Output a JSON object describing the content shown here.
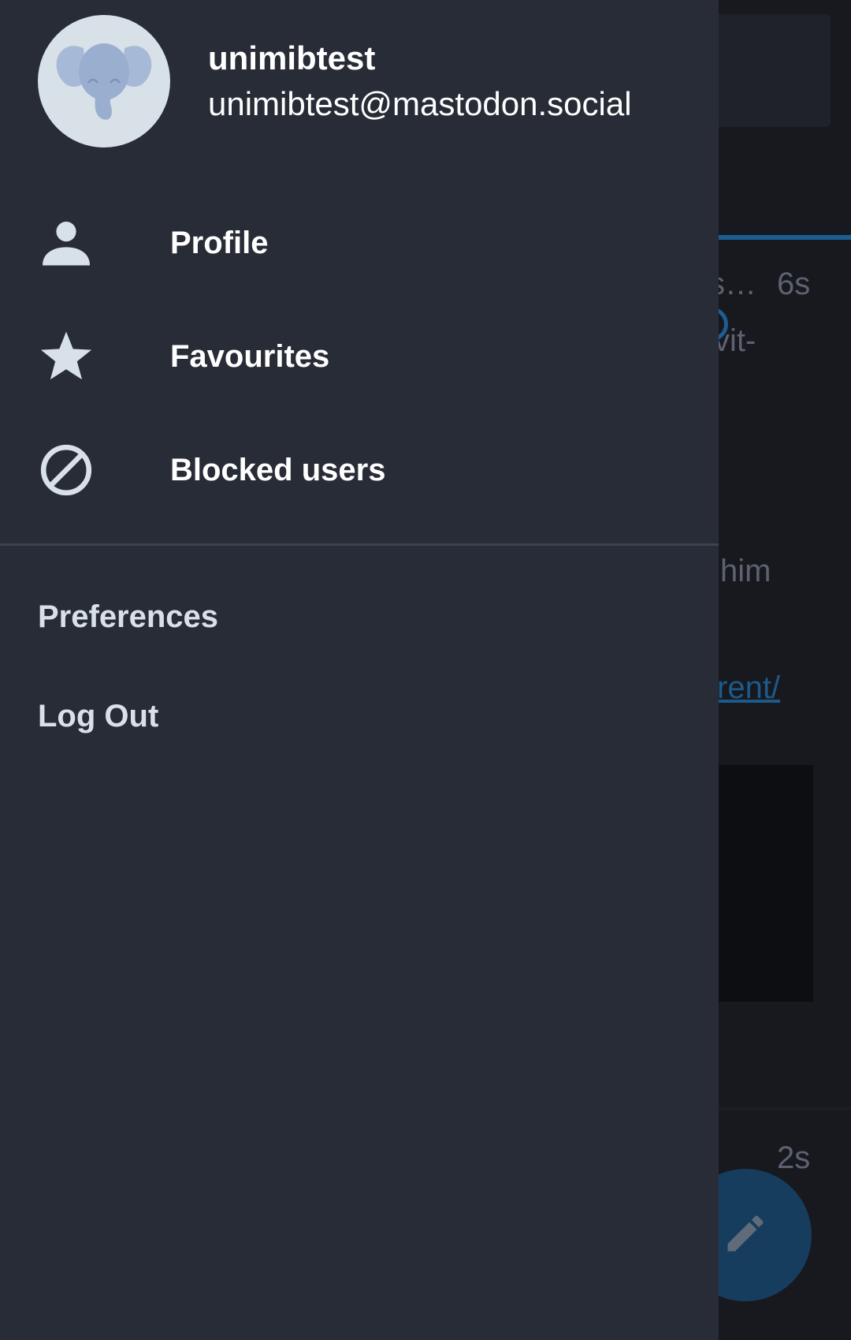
{
  "background": {
    "timeline_fragments": {
      "time_1": "6s",
      "text_1": "s…",
      "text_2": "vit-",
      "text_3": "him",
      "link_1": "rent/",
      "time_2": "2s"
    },
    "compose_fab_icon": "pencil-icon",
    "accent_color": "#2b90d9"
  },
  "drawer": {
    "account": {
      "display_name": "unimibtest",
      "handle": "unimibtest@mastodon.social",
      "avatar_icon": "elephant-icon"
    },
    "menu": [
      {
        "label": "Profile",
        "icon": "person-icon"
      },
      {
        "label": "Favourites",
        "icon": "star-icon"
      },
      {
        "label": "Blocked users",
        "icon": "block-icon"
      }
    ],
    "secondary": [
      {
        "label": "Preferences"
      },
      {
        "label": "Log Out"
      }
    ],
    "colors": {
      "drawer_bg": "#282c37",
      "icon": "#d9e1e8",
      "divider": "#3d4252"
    }
  }
}
